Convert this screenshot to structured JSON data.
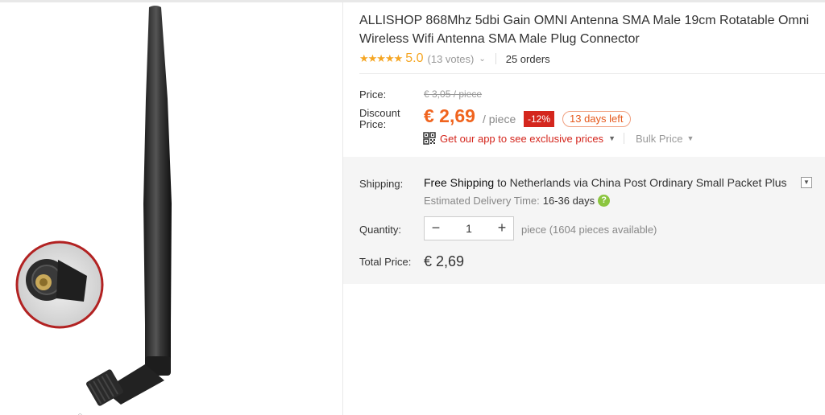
{
  "product": {
    "title": "ALLISHOP 868Mhz 5dbi Gain OMNI Antenna SMA Male 19cm Rotatable Omni Wireless Wifi Antenna SMA Male Plug Connector",
    "stars": "★★★★★",
    "rating": "5.0",
    "votes": "(13 votes)",
    "orders": "25 orders"
  },
  "pricing": {
    "price_label": "Price:",
    "original_price": "€ 3,05 / piece",
    "discount_label_1": "Discount",
    "discount_label_2": "Price:",
    "discount_price": "€ 2,69",
    "per_piece": "/ piece",
    "discount_badge": "-12%",
    "days_left": "13 days left",
    "app_link": "Get our app to see exclusive prices",
    "bulk_price": "Bulk Price"
  },
  "shipping": {
    "label": "Shipping:",
    "free_shipping": "Free Shipping",
    "destination": "to Netherlands via China Post Ordinary Small Packet Plus",
    "estimated_label": "Estimated Delivery Time:",
    "estimated_days": "16-36 days",
    "help": "?"
  },
  "quantity": {
    "label": "Quantity:",
    "decrement": "−",
    "value": "1",
    "increment": "+",
    "available": "piece (1604 pieces available)"
  },
  "total": {
    "label": "Total Price:",
    "value": "€ 2,69"
  },
  "colors": {
    "accent_orange": "#f0641e",
    "star_gold": "#f5a623",
    "badge_red": "#d4261d",
    "help_green": "#8bc53f"
  }
}
